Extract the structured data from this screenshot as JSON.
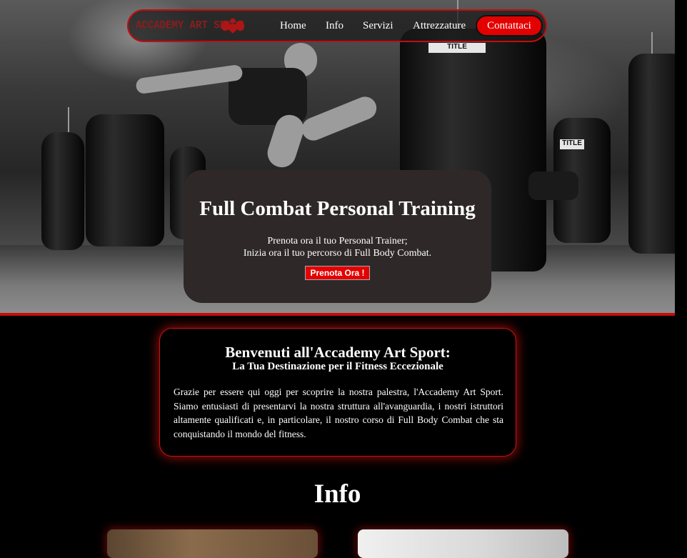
{
  "nav": {
    "brand": "ACCADEMY ART SPORT",
    "links": [
      "Home",
      "Info",
      "Servizi",
      "Attrezzature"
    ],
    "cta": "Contattaci"
  },
  "hero": {
    "title": "Full Combat Personal Training",
    "line1": "Prenota ora il tuo Personal Trainer;",
    "line2": "Inizia ora il tuo percorso di Full Body Combat.",
    "button": "Prenota Ora !",
    "bag_brand": "TITLE"
  },
  "welcome": {
    "title": "Benvenuti all'Accademy Art Sport:",
    "subtitle": "La Tua Destinazione per il Fitness Eccezionale",
    "body": "Grazie per essere qui oggi per scoprire la nostra palestra, l'Accademy Art Sport. Siamo entusiasti di presentarvi la nostra struttura all'avanguardia, i nostri istruttori altamente qualificati e, in particolare, il nostro corso di Full Body Combat che sta conquistando il mondo del fitness."
  },
  "info": {
    "title": "Info"
  },
  "colors": {
    "accent": "#e30000",
    "border": "#c40d0d",
    "card": "#2e2828"
  },
  "icons": {
    "brand": "flexing-arms-icon"
  }
}
